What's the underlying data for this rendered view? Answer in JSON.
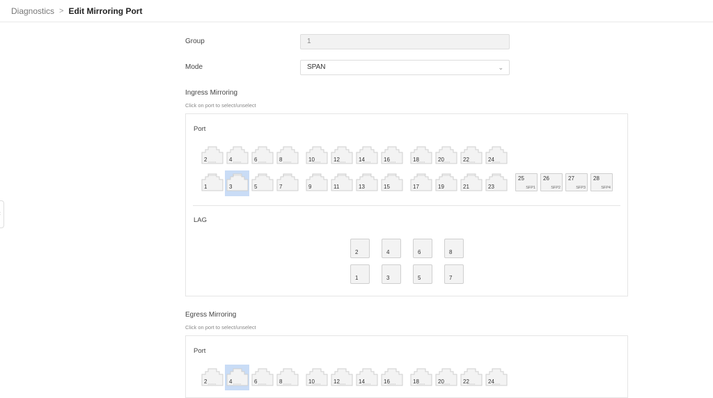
{
  "breadcrumb": {
    "parent": "Diagnostics",
    "separator": ">",
    "current": "Edit Mirroring Port"
  },
  "form": {
    "group_label": "Group",
    "group_value": "1",
    "mode_label": "Mode",
    "mode_value": "SPAN"
  },
  "ingress": {
    "title": "Ingress Mirroring",
    "hint": "Click on port to select/unselect",
    "port_label": "Port",
    "lag_label": "LAG",
    "top_ports": [
      "2",
      "4",
      "6",
      "8",
      "10",
      "12",
      "14",
      "16",
      "18",
      "20",
      "22",
      "24"
    ],
    "bottom_ports": [
      "1",
      "3",
      "5",
      "7",
      "9",
      "11",
      "13",
      "15",
      "17",
      "19",
      "21",
      "23"
    ],
    "sfp_ports": [
      {
        "num": "25",
        "sub": "SFP1"
      },
      {
        "num": "26",
        "sub": "SFP2"
      },
      {
        "num": "27",
        "sub": "SFP3"
      },
      {
        "num": "28",
        "sub": "SFP4"
      }
    ],
    "selected_port": "3",
    "lag_top": [
      "2",
      "4",
      "6",
      "8"
    ],
    "lag_bottom": [
      "1",
      "3",
      "5",
      "7"
    ]
  },
  "egress": {
    "title": "Egress Mirroring",
    "hint": "Click on port to select/unselect",
    "port_label": "Port",
    "top_ports": [
      "2",
      "4",
      "6",
      "8",
      "10",
      "12",
      "14",
      "16",
      "18",
      "20",
      "22",
      "24"
    ],
    "selected_port": "4"
  },
  "colors": {
    "selected": "#c9dcf6",
    "port_fill": "#f3f3f3",
    "port_border": "#cfcfcf"
  }
}
